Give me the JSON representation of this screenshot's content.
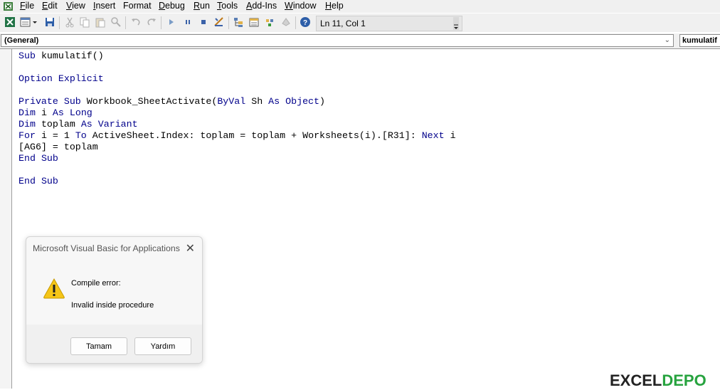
{
  "menu": {
    "items": [
      {
        "label": "File",
        "ul": "F",
        "rest": "ile"
      },
      {
        "label": "Edit",
        "ul": "E",
        "rest": "dit"
      },
      {
        "label": "View",
        "ul": "V",
        "rest": "iew"
      },
      {
        "label": "Insert",
        "ul": "I",
        "rest": "nsert"
      },
      {
        "label": "Format",
        "ul": "F",
        "rest": "ormat",
        "pre": "",
        "ulIndex": 1
      },
      {
        "label": "Debug",
        "ul": "D",
        "rest": "ebug"
      },
      {
        "label": "Run",
        "ul": "R",
        "rest": "un"
      },
      {
        "label": "Tools",
        "ul": "T",
        "rest": "ools"
      },
      {
        "label": "Add-Ins",
        "ul": "A",
        "rest": "dd-Ins"
      },
      {
        "label": "Window",
        "ul": "W",
        "rest": "indow"
      },
      {
        "label": "Help",
        "ul": "H",
        "rest": "elp"
      }
    ]
  },
  "toolbar": {
    "status": "Ln 11, Col 1"
  },
  "combos": {
    "object": "(General)",
    "procedure": "kumulatif"
  },
  "code": {
    "lines": [
      "Sub kumulatif()",
      "",
      "Option Explicit",
      "",
      "Private Sub Workbook_SheetActivate(ByVal Sh As Object)",
      "Dim i As Long",
      "Dim toplam As Variant",
      "For i = 1 To ActiveSheet.Index: toplam = toplam + Worksheets(i).[R31]: Next i",
      "[AG6] = toplam",
      "End Sub",
      "",
      "End Sub"
    ]
  },
  "dialog": {
    "title": "Microsoft Visual Basic for Applications",
    "message_title": "Compile error:",
    "message_body": "Invalid inside procedure",
    "ok_label": "Tamam",
    "help_label": "Yardım",
    "icon": "warning-icon"
  },
  "watermark": {
    "part1": "EXCEL",
    "part2": "DEPO"
  },
  "colors": {
    "keyword": "#00008b",
    "watermark_green": "#27a33f",
    "warning_yellow": "#f5c518"
  }
}
